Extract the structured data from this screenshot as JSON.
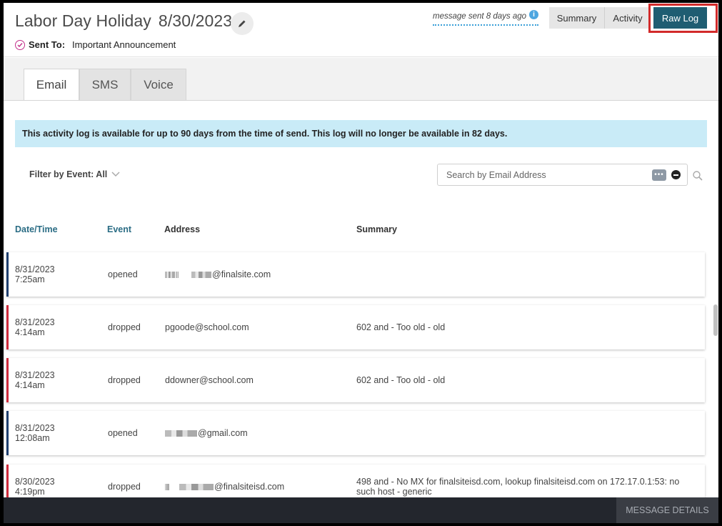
{
  "header": {
    "title": "Labor Day Holiday",
    "date": "8/30/2023",
    "sent_to_label": "Sent To:",
    "sent_to_value": "Important Announcement",
    "sent_ago": "message sent 8 days ago",
    "info_glyph": "i",
    "buttons": {
      "summary": "Summary",
      "activity": "Activity",
      "raw_log": "Raw Log"
    }
  },
  "tabs": {
    "email": "Email",
    "sms": "SMS",
    "voice": "Voice"
  },
  "notice": "This activity log is available for up to 90 days from the time of send. This log will no longer be available in 82 days.",
  "filter": {
    "label": "Filter by Event: All"
  },
  "search": {
    "placeholder": "Search by Email Address",
    "dots": "•••"
  },
  "columns": {
    "datetime": "Date/Time",
    "event": "Event",
    "address": "Address",
    "summary": "Summary"
  },
  "rows": [
    {
      "date": "8/31/2023",
      "time": "7:25am",
      "event": "opened",
      "address": "@finalsite.com",
      "summary": ""
    },
    {
      "date": "8/31/2023",
      "time": "4:14am",
      "event": "dropped",
      "address": "pgoode@school.com",
      "summary": "602 and - Too old - old"
    },
    {
      "date": "8/31/2023",
      "time": "4:14am",
      "event": "dropped",
      "address": "ddowner@school.com",
      "summary": "602 and - Too old - old"
    },
    {
      "date": "8/31/2023",
      "time": "12:08am",
      "event": "opened",
      "address": "@gmail.com",
      "summary": ""
    },
    {
      "date": "8/30/2023",
      "time": "4:19pm",
      "event": "dropped",
      "address": "@finalsiteisd.com",
      "summary": "498 and - No MX for finalsiteisd.com, lookup finalsiteisd.com on 172.17.0.1:53: no such host - generic"
    }
  ],
  "footer": {
    "tab": "MESSAGE DETAILS"
  },
  "colors": {
    "accent": "#1f5d72",
    "opened_bar": "#1f3f6e",
    "dropped_bar": "#cf2a3a",
    "notice_bg": "#c9ebf7",
    "highlight": "#d22a2a"
  },
  "icons": [
    "pencil-icon",
    "check-circle-icon",
    "info-icon",
    "chevron-down-icon",
    "more-dots-icon",
    "clear-icon",
    "search-icon"
  ]
}
